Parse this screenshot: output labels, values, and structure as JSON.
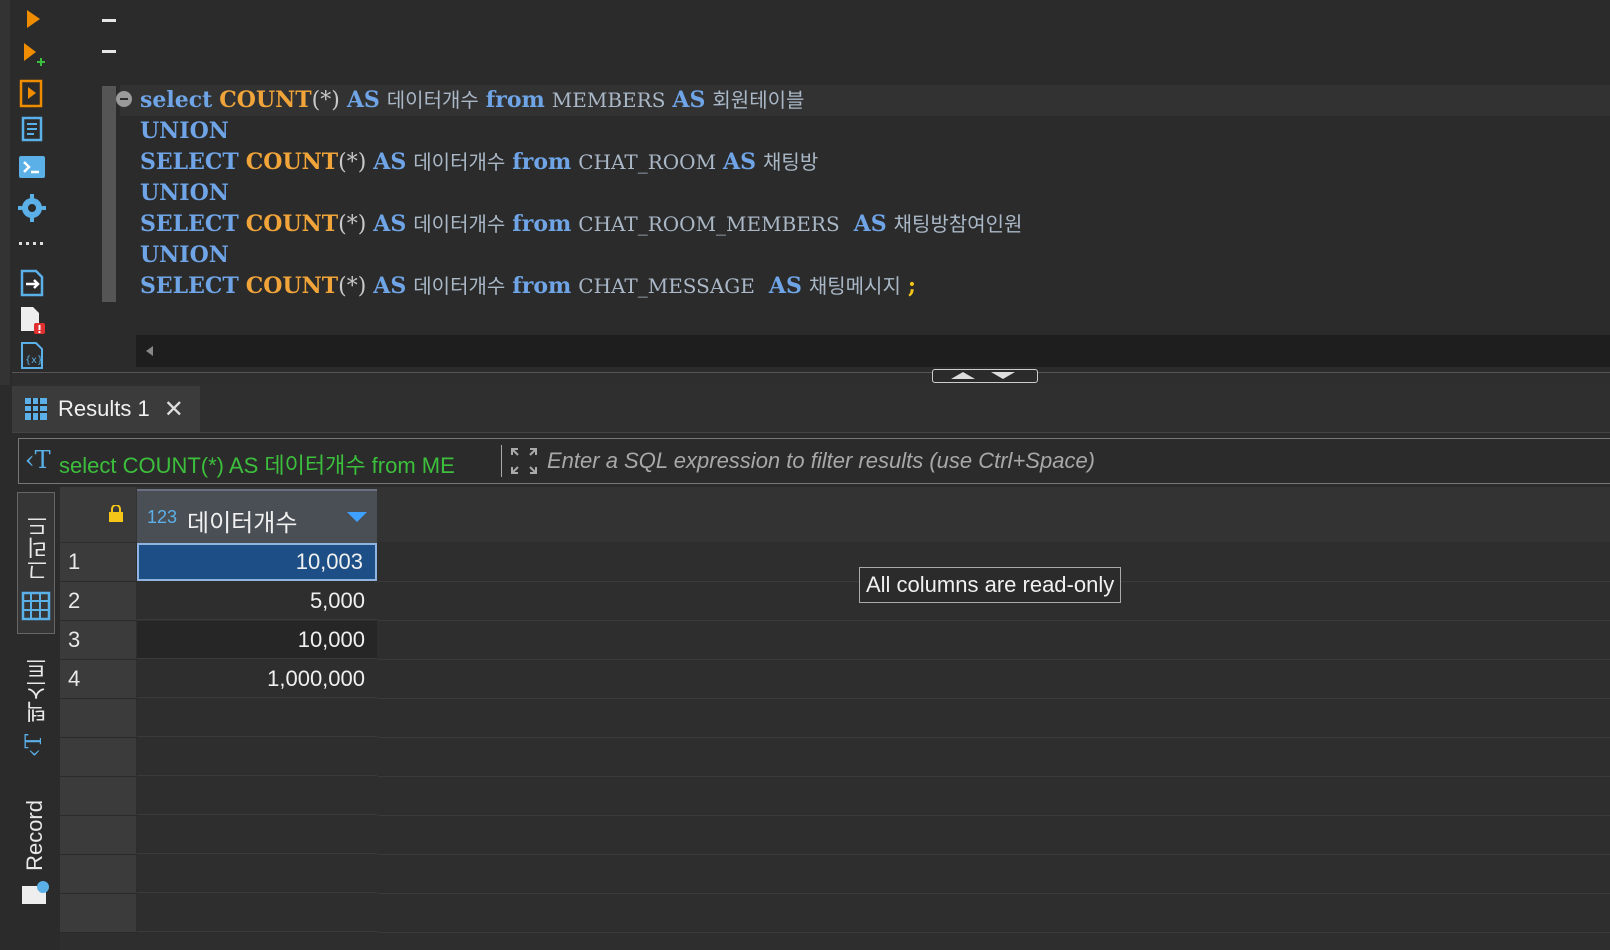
{
  "toolbar": {
    "icons": [
      "execute-icon",
      "execute-new-tab-icon",
      "execute-script-icon",
      "explain-plan-icon",
      "terminal-icon",
      "settings-icon",
      "more-icon",
      "export-icon",
      "error-log-icon",
      "variables-icon"
    ]
  },
  "editor": {
    "lines": [
      [
        {
          "t": "select",
          "c": "kw"
        },
        {
          "t": " "
        },
        {
          "t": "COUNT",
          "c": "fn"
        },
        {
          "t": "(*)",
          "c": "punc"
        },
        {
          "t": " "
        },
        {
          "t": "AS",
          "c": "kw"
        },
        {
          "t": " "
        },
        {
          "t": "데이터개수",
          "c": "ident"
        },
        {
          "t": " "
        },
        {
          "t": "from",
          "c": "kw"
        },
        {
          "t": " "
        },
        {
          "t": "MEMBERS",
          "c": "ident"
        },
        {
          "t": " "
        },
        {
          "t": "AS",
          "c": "kw"
        },
        {
          "t": " "
        },
        {
          "t": "회원테이블",
          "c": "ident"
        }
      ],
      [
        {
          "t": "UNION",
          "c": "kw"
        }
      ],
      [
        {
          "t": "SELECT",
          "c": "kw"
        },
        {
          "t": " "
        },
        {
          "t": "COUNT",
          "c": "fn"
        },
        {
          "t": "(*)",
          "c": "punc"
        },
        {
          "t": " "
        },
        {
          "t": "AS",
          "c": "kw"
        },
        {
          "t": " "
        },
        {
          "t": "데이터개수",
          "c": "ident"
        },
        {
          "t": " "
        },
        {
          "t": "from",
          "c": "kw"
        },
        {
          "t": " "
        },
        {
          "t": "CHAT_ROOM",
          "c": "ident"
        },
        {
          "t": " "
        },
        {
          "t": "AS",
          "c": "kw"
        },
        {
          "t": " "
        },
        {
          "t": "채팅방",
          "c": "ident"
        }
      ],
      [
        {
          "t": "UNION",
          "c": "kw"
        }
      ],
      [
        {
          "t": "SELECT",
          "c": "kw"
        },
        {
          "t": " "
        },
        {
          "t": "COUNT",
          "c": "fn"
        },
        {
          "t": "(*)",
          "c": "punc"
        },
        {
          "t": " "
        },
        {
          "t": "AS",
          "c": "kw"
        },
        {
          "t": " "
        },
        {
          "t": "데이터개수",
          "c": "ident"
        },
        {
          "t": " "
        },
        {
          "t": "from",
          "c": "kw"
        },
        {
          "t": " "
        },
        {
          "t": "CHAT_ROOM_MEMBERS",
          "c": "ident"
        },
        {
          "t": "  "
        },
        {
          "t": "AS",
          "c": "kw"
        },
        {
          "t": " "
        },
        {
          "t": "채팅방참여인원",
          "c": "ident"
        }
      ],
      [
        {
          "t": "UNION",
          "c": "kw"
        }
      ],
      [
        {
          "t": "SELECT",
          "c": "kw"
        },
        {
          "t": " "
        },
        {
          "t": "COUNT",
          "c": "fn"
        },
        {
          "t": "(*)",
          "c": "punc"
        },
        {
          "t": " "
        },
        {
          "t": "AS",
          "c": "kw"
        },
        {
          "t": " "
        },
        {
          "t": "데이터개수",
          "c": "ident"
        },
        {
          "t": " "
        },
        {
          "t": "from",
          "c": "kw"
        },
        {
          "t": " "
        },
        {
          "t": "CHAT_MESSAGE",
          "c": "ident"
        },
        {
          "t": "  "
        },
        {
          "t": "AS",
          "c": "kw"
        },
        {
          "t": " "
        },
        {
          "t": "채팅메시지",
          "c": "ident"
        },
        {
          "t": " "
        },
        {
          "t": ";",
          "c": "semi"
        }
      ]
    ]
  },
  "results": {
    "tab_label": "Results 1",
    "filter": {
      "query_label": "select COUNT(*) AS 데이터개수 from ME",
      "placeholder": "Enter a SQL expression to filter results (use Ctrl+Space)"
    },
    "side_tabs": {
      "grid": "그리드",
      "text": "텍스트",
      "record": "Record"
    },
    "column": {
      "type": "123",
      "name": "데이터개수"
    },
    "rows": [
      {
        "num": "1",
        "value": "10,003"
      },
      {
        "num": "2",
        "value": "5,000"
      },
      {
        "num": "3",
        "value": "10,000"
      },
      {
        "num": "4",
        "value": "1,000,000"
      }
    ],
    "tooltip": "All columns are read-only"
  },
  "colors": {
    "keyword": "#6fa4e7",
    "function": "#f0a43a",
    "accent_blue": "#3ea0ff",
    "selection": "#1d4f86",
    "filter_query": "#3cbf3c"
  }
}
